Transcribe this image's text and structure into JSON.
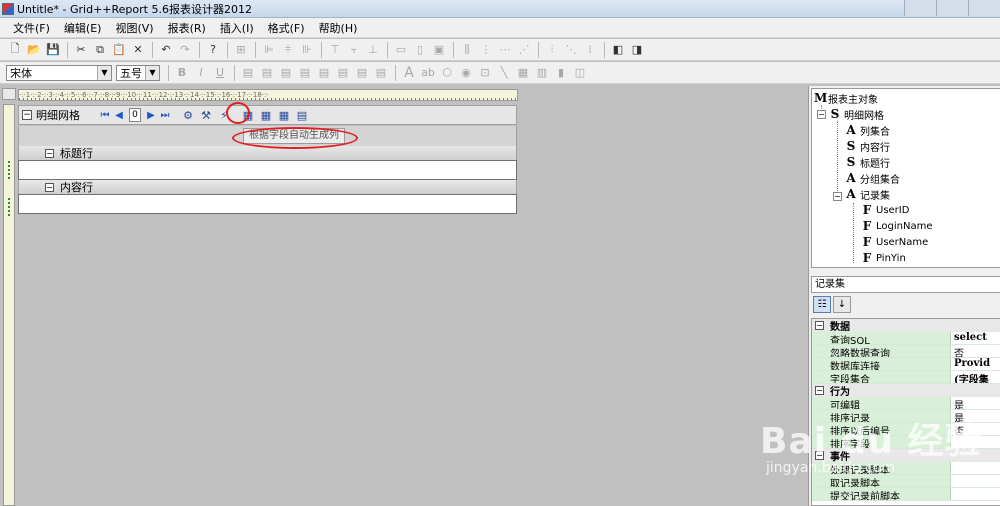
{
  "window": {
    "title": "Untitle* - Grid++Report 5.6报表设计器2012"
  },
  "menu": [
    "文件(F)",
    "编辑(E)",
    "视图(V)",
    "报表(R)",
    "插入(I)",
    "格式(F)",
    "帮助(H)"
  ],
  "format_toolbar": {
    "font_name": "宋体",
    "font_size": "五号",
    "bold": "B",
    "italic": "I",
    "underline": "U",
    "text_tool": "A",
    "abc_tool": "ab"
  },
  "ruler": {
    "text": "·:·1·:·2·:·3·:·4·:·5·:·6·:·7·:·8·:·9·:·10·:·11·:·12·:·13·:·14·:·15·:·16·:·17·:·18·:·"
  },
  "grid": {
    "title": "明细网格",
    "page_value": "0",
    "tooltip": "根据字段自动生成列",
    "title_band": "标题行",
    "content_band": "内容行"
  },
  "tree": {
    "nodes": [
      {
        "icon": "M",
        "label": "报表主对象"
      },
      {
        "icon": "S",
        "label": "明细网格"
      },
      {
        "icon": "A",
        "label": "列集合"
      },
      {
        "icon": "S",
        "label": "内容行"
      },
      {
        "icon": "S",
        "label": "标题行"
      },
      {
        "icon": "A",
        "label": "分组集合"
      },
      {
        "icon": "A",
        "label": "记录集"
      },
      {
        "icon": "F",
        "label": "UserID"
      },
      {
        "icon": "F",
        "label": "LoginName"
      },
      {
        "icon": "F",
        "label": "UserName"
      },
      {
        "icon": "F",
        "label": "PinYin"
      }
    ]
  },
  "properties": {
    "object_name": "记录集",
    "categories": {
      "data": "数据",
      "behavior": "行为",
      "events": "事件"
    },
    "rows": [
      {
        "name": "查询SQL",
        "value": "select"
      },
      {
        "name": "忽略数据查询",
        "value": "否"
      },
      {
        "name": "数据库连接",
        "value": "Provid"
      },
      {
        "name": "字段集合",
        "value": "(字段集"
      },
      {
        "name": "可编辑",
        "value": "是"
      },
      {
        "name": "排序记录",
        "value": "是"
      },
      {
        "name": "排序以后编号",
        "value": "否"
      },
      {
        "name": "排序字段",
        "value": ""
      },
      {
        "name": "处理记录脚本",
        "value": ""
      },
      {
        "name": "取记录脚本",
        "value": ""
      },
      {
        "name": "提交记录前脚本",
        "value": ""
      }
    ]
  },
  "watermark": {
    "main": "Bai du 经验",
    "sub": "jingyan.baidu.com"
  },
  "colors": {
    "highlight": "#e02020",
    "property_name_bg": "#d8f0d8",
    "ruler_bg": "#f4f4dc"
  }
}
